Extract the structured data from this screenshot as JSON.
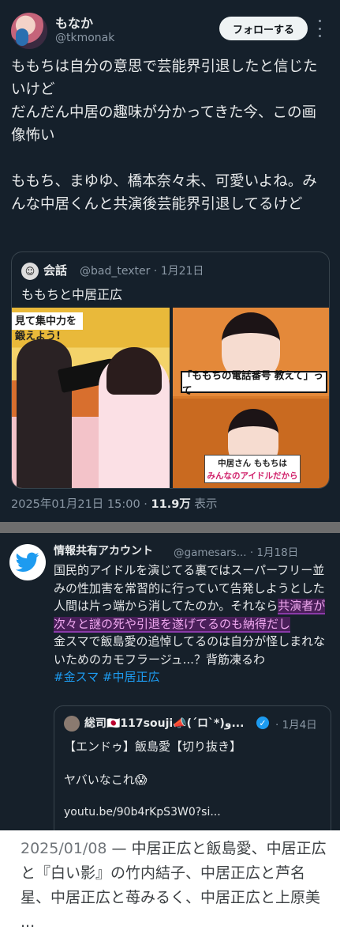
{
  "tweet": {
    "display_name": "もなか",
    "handle": "@tkmonak",
    "follow_label": "フォローする",
    "lines": [
      "ももちは自分の意思で芸能界引退したと信じたいけど",
      "だんだん中居の趣味が分かってきた今、この画像怖い",
      "",
      "ももち、まゆゆ、橋本奈々未、可愛いよね。みんな中居くんと共演後芸能界引退してるけど"
    ],
    "quote": {
      "name": "会話",
      "handle": "@bad_texter · 1月21日",
      "text": "ももちと中居正広",
      "image_left_banner": "見て集中力を鍛えよう!",
      "image_right_caption": "「ももちの電話番号 教えて」って",
      "image_right_caption2_line1": "中居さん ももちは",
      "image_right_caption2_line2": "みんなのアイドルだから"
    },
    "timestamp": "2025年01月21日 15:00 · ",
    "views_count": "11.9万",
    "views_label": " 表示"
  },
  "tweet2": {
    "display_name": "情報共有アカウント",
    "handle_date": "@gamesars... · 1月18日",
    "text_before": "国民的アイドルを演じてる裏ではスーパーフリー並みの性加害を常習的に行っていて告発しようとした人間は片っ端から消してたのか。それなら",
    "text_highlight": "共演者が次々と謎の死や引退を遂げてるのも納得だし",
    "text_after": "金スマで飯島愛の追悼してるのは自分が怪しまれないためのカモフラージュ...？背筋凍るわ",
    "hashtags": "#金スマ #中居正広",
    "quote": {
      "name": "総司🇯🇵117souji📣(´ロ`*)ﻭ...",
      "date": "· 1月4日",
      "line1": "【エンドゥ】飯島愛【切り抜き】",
      "line2": "ヤバいなこれ😱",
      "link": "youtu.be/90b4rKpS3W0?si..."
    }
  },
  "snippet": {
    "date": "2025/01/08",
    "text": " — 中居正広と飯島愛、中居正広と『白い影』の竹内結子、中居正広と芦名星、中居正広と苺みるく、中居正広と上原美 ..."
  }
}
